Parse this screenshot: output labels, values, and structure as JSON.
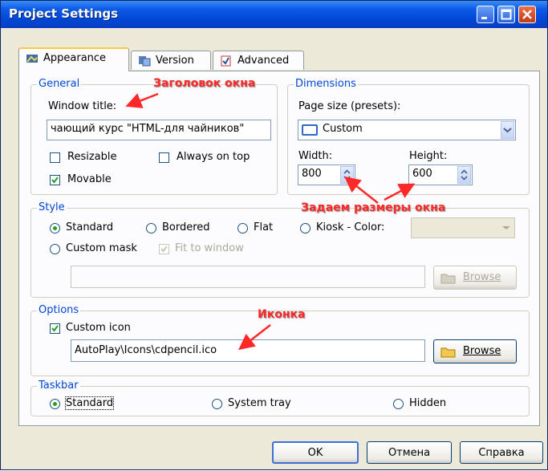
{
  "window": {
    "title": "Project Settings"
  },
  "tabs": [
    {
      "label": "Appearance",
      "active": true
    },
    {
      "label": "Version",
      "active": false
    },
    {
      "label": "Advanced",
      "active": false
    }
  ],
  "general": {
    "legend": "General",
    "window_title_label": "Window title:",
    "window_title_value": "чающий курс \"HTML-для чайников\"",
    "resizable_label": "Resizable",
    "resizable_checked": false,
    "always_on_top_label": "Always on top",
    "always_on_top_checked": false,
    "movable_label": "Movable",
    "movable_checked": true
  },
  "dimensions": {
    "legend": "Dimensions",
    "page_size_label": "Page size (presets):",
    "page_size_value": "Custom",
    "width_label": "Width:",
    "width_value": "800",
    "height_label": "Height:",
    "height_value": "600"
  },
  "style": {
    "legend": "Style",
    "options": [
      "Standard",
      "Bordered",
      "Flat",
      "Kiosk - Color:",
      "Custom mask"
    ],
    "selected": "Standard",
    "fit_to_window_label": "Fit to window",
    "browse_label": "Browse"
  },
  "options": {
    "legend": "Options",
    "custom_icon_label": "Custom icon",
    "custom_icon_checked": true,
    "icon_path": "AutoPlay\\Icons\\cdpencil.ico",
    "browse_label": "Browse"
  },
  "taskbar": {
    "legend": "Taskbar",
    "options": [
      "Standard",
      "System tray",
      "Hidden"
    ],
    "selected": "Standard"
  },
  "buttons": {
    "ok": "OK",
    "cancel": "Отмена",
    "help": "Справка"
  },
  "annotations": {
    "title_note": "Заголовок окна",
    "size_note": "Задаем размеры окна",
    "icon_note": "Иконка"
  },
  "colors": {
    "accent": "#0046D5",
    "annotation": "#FF2828",
    "selected_radio": "#21A121"
  }
}
